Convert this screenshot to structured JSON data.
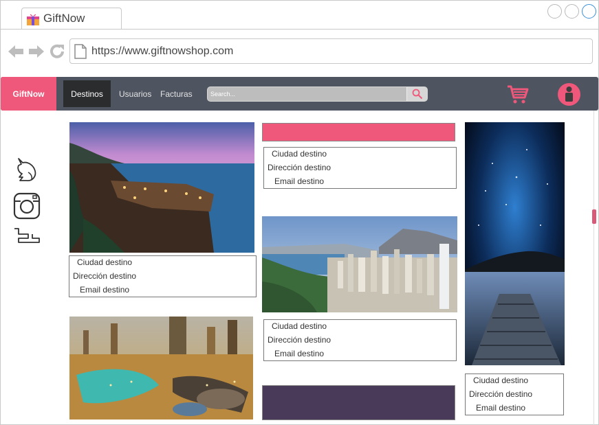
{
  "browser": {
    "tab_title": "GiftNow",
    "url": "https://www.giftnowshop.com"
  },
  "header": {
    "brand": "GiftNow",
    "nav": [
      "Destinos",
      "Usuarios",
      "Facturas"
    ],
    "search_placeholder": "Search...",
    "accent_color": "#ef587a",
    "bar_color": "#4e5561"
  },
  "social_icons": [
    "fox-icon",
    "instagram-icon",
    "tumblr-icon"
  ],
  "cards": {
    "c1": {
      "city": "Ciudad destino",
      "address": "Dirección destino",
      "email": "Email destino"
    },
    "c2": {
      "city": "Ciudad destino",
      "address": "Dirección destino",
      "email": "Email destino"
    },
    "c3": {
      "city": "Ciudad destino",
      "address": "Dirección destino",
      "email": "Email destino"
    },
    "c4": {
      "city": "Ciudad destino",
      "address": "Dirección destino",
      "email": "Email destino"
    }
  }
}
